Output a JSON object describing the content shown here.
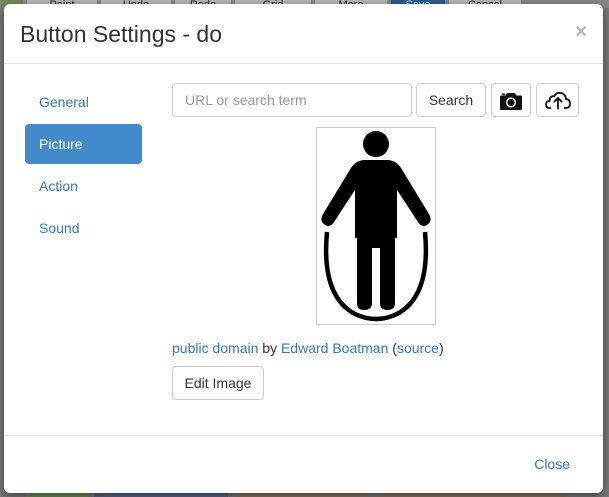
{
  "background": {
    "toolbar_buttons": [
      "Paint",
      "Undo",
      "Redo",
      "Grid",
      "More",
      "Save",
      "Cancel"
    ]
  },
  "modal": {
    "title": "Button Settings - do",
    "close_symbol": "×"
  },
  "nav": {
    "items": [
      {
        "label": "General",
        "active": false
      },
      {
        "label": "Picture",
        "active": true
      },
      {
        "label": "Action",
        "active": false
      },
      {
        "label": "Sound",
        "active": false
      }
    ]
  },
  "search": {
    "placeholder": "URL or search term",
    "value": "",
    "button_label": "Search",
    "camera_icon": "camera-icon",
    "upload_icon": "cloud-upload-icon"
  },
  "picture": {
    "icon": "jump-rope-figure-icon"
  },
  "attribution": {
    "license": "public domain",
    "by": "by",
    "author": "Edward Boatman",
    "open_paren": "(",
    "source": "source",
    "close_paren": ")"
  },
  "edit_button": "Edit Image",
  "footer": {
    "close_label": "Close"
  },
  "colors": {
    "accent": "#428bca",
    "link": "#337ab7",
    "text": "#333333"
  }
}
